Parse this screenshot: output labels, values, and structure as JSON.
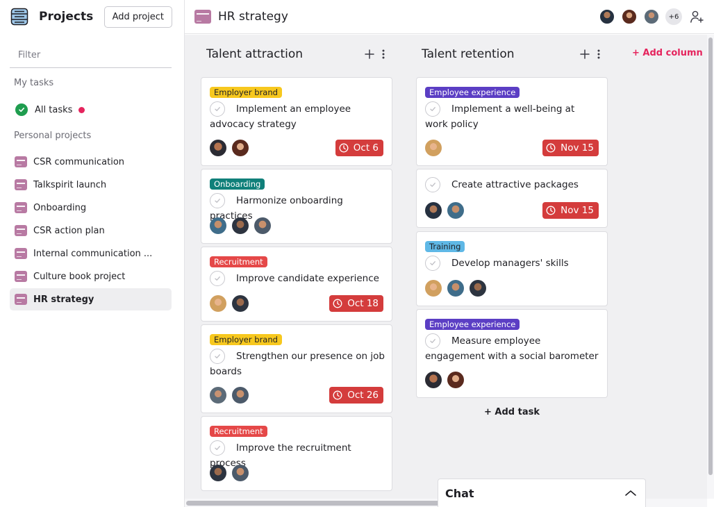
{
  "sidebar": {
    "title": "Projects",
    "add_project_label": "Add project",
    "filter_placeholder": "Filter",
    "my_tasks_heading": "My tasks",
    "all_tasks_label": "All tasks",
    "personal_projects_heading": "Personal projects",
    "projects": [
      {
        "label": "CSR communication"
      },
      {
        "label": "Talkspirit launch"
      },
      {
        "label": "Onboarding"
      },
      {
        "label": "CSR action plan"
      },
      {
        "label": "Internal communication ..."
      },
      {
        "label": "Culture book project"
      },
      {
        "label": "HR strategy",
        "active": true
      }
    ]
  },
  "topbar": {
    "project_title": "HR strategy",
    "extra_members": "+6"
  },
  "board": {
    "add_column_label": "+ Add column",
    "add_task_label": "+ Add task",
    "columns": [
      {
        "title": "Talent attraction",
        "cards": [
          {
            "tag": "Employer brand",
            "title": "Implement an employee advocacy strategy",
            "due": "Oct 6"
          },
          {
            "tag": "Onboarding",
            "title": "Harmonize onboarding practices"
          },
          {
            "tag": "Recruitment",
            "title": "Improve candidate experience",
            "due": "Oct 18"
          },
          {
            "tag": "Employer brand",
            "title": "Strengthen our presence on job boards",
            "due": "Oct 26"
          },
          {
            "tag": "Recruitment",
            "title": "Improve the recruitment process"
          }
        ]
      },
      {
        "title": "Talent retention",
        "cards": [
          {
            "tag": "Employee experience",
            "title": "Implement a well-being at work policy",
            "due": "Nov 15"
          },
          {
            "title": "Create attractive packages",
            "due": "Nov 15"
          },
          {
            "tag": "Training",
            "title": "Develop managers' skills"
          },
          {
            "tag": "Employee experience",
            "title": "Measure employee engagement with a social barometer"
          }
        ]
      }
    ]
  },
  "chat": {
    "label": "Chat"
  },
  "colors": {
    "accent": "#e5245d",
    "due_bg": "#d43c3c",
    "project_icon": "#b87aa3",
    "tag_employer_brand": "#f7c81e",
    "tag_onboarding": "#10807a",
    "tag_recruitment": "#e54848",
    "tag_employee_experience": "#5b3ec4",
    "tag_training": "#5fb8e6"
  }
}
